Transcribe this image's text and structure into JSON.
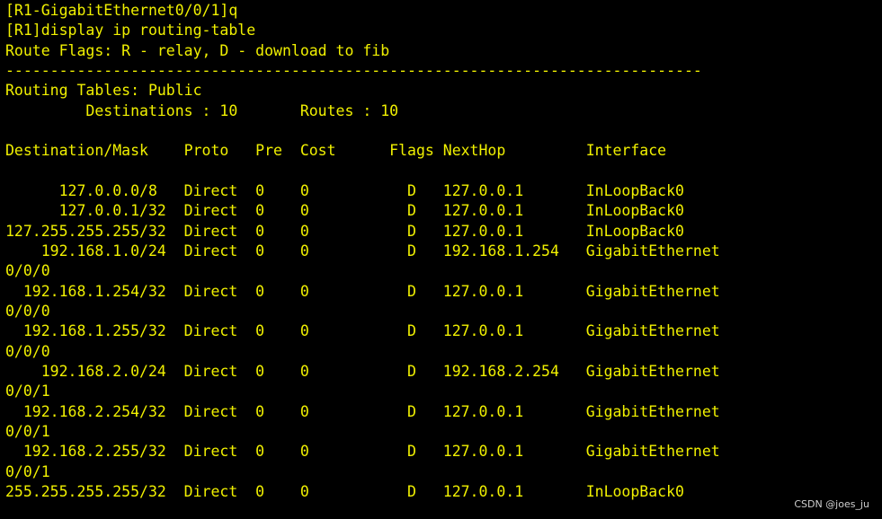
{
  "terminal": {
    "text_color": "#f0f000",
    "background": "#000000",
    "lines": [
      "[R1-GigabitEthernet0/0/1]q",
      "[R1]display ip routing-table",
      "Route Flags: R - relay, D - download to fib",
      "------------------------------------------------------------------------------",
      "Routing Tables: Public",
      "         Destinations : 10       Routes : 10",
      "",
      "Destination/Mask    Proto   Pre  Cost      Flags NextHop         Interface",
      "",
      "      127.0.0.0/8   Direct  0    0           D   127.0.0.1       InLoopBack0",
      "      127.0.0.1/32  Direct  0    0           D   127.0.0.1       InLoopBack0",
      "127.255.255.255/32  Direct  0    0           D   127.0.0.1       InLoopBack0",
      "    192.168.1.0/24  Direct  0    0           D   192.168.1.254   GigabitEthernet",
      "0/0/0",
      "  192.168.1.254/32  Direct  0    0           D   127.0.0.1       GigabitEthernet",
      "0/0/0",
      "  192.168.1.255/32  Direct  0    0           D   127.0.0.1       GigabitEthernet",
      "0/0/0",
      "    192.168.2.0/24  Direct  0    0           D   192.168.2.254   GigabitEthernet",
      "0/0/1",
      "  192.168.2.254/32  Direct  0    0           D   127.0.0.1       GigabitEthernet",
      "0/0/1",
      "  192.168.2.255/32  Direct  0    0           D   127.0.0.1       GigabitEthernet",
      "0/0/1",
      "255.255.255.255/32  Direct  0    0           D   127.0.0.1       InLoopBack0"
    ]
  },
  "watermark": {
    "text": "CSDN @joes_ju"
  }
}
